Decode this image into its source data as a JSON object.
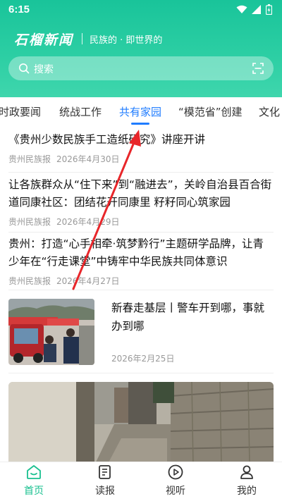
{
  "status_bar": {
    "time": "6:15"
  },
  "header": {
    "logo": "石榴新闻",
    "slogan": "民族的 · 即世界的"
  },
  "search": {
    "placeholder": "搜索"
  },
  "tabs": [
    {
      "label": "时政要闻",
      "active": false
    },
    {
      "label": "统战工作",
      "active": false
    },
    {
      "label": "共有家园",
      "active": true
    },
    {
      "label": "“模范省”创建",
      "active": false
    },
    {
      "label": "文化",
      "active": false
    }
  ],
  "news": [
    {
      "title": "《贵州少数民族手工造纸研究》讲座开讲",
      "source": "贵州民族报",
      "date": "2026年4月30日"
    },
    {
      "title": "让各族群众从“住下来”到“融进去”，关岭自治县百合街道同康社区：团结花开同康里 籽籽同心筑家园",
      "source": "贵州民族报",
      "date": "2026年4月29日"
    },
    {
      "title": "贵州：打造“心手相牵·筑梦黔行”主题研学品牌，让青少年在“行走课堂”中铸牢中华民族共同体意识",
      "source": "贵州民族报",
      "date": "2026年4月27日"
    }
  ],
  "image_news": {
    "title": "新春走基层丨警车开到哪，事就办到哪",
    "date": "2026年2月25日"
  },
  "bottom_nav": [
    {
      "label": "首页",
      "icon": "home-icon",
      "active": true
    },
    {
      "label": "读报",
      "icon": "newspaper-icon",
      "active": false
    },
    {
      "label": "视听",
      "icon": "play-icon",
      "active": false
    },
    {
      "label": "我的",
      "icon": "user-icon",
      "active": false
    }
  ],
  "colors": {
    "header": "#2dcfa4",
    "active_tab": "#1f7cff",
    "active_nav": "#18c08f",
    "arrow": "#e8262a"
  }
}
